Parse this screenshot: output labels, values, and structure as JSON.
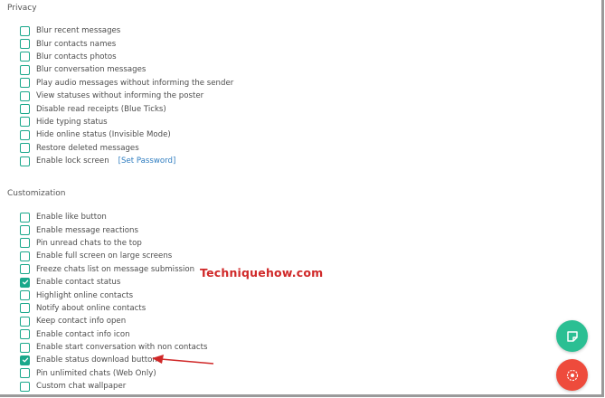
{
  "privacy": {
    "title": "Privacy",
    "options": [
      {
        "label": "Blur recent messages",
        "checked": false
      },
      {
        "label": "Blur contacts names",
        "checked": false
      },
      {
        "label": "Blur contacts photos",
        "checked": false
      },
      {
        "label": "Blur conversation messages",
        "checked": false
      },
      {
        "label": "Play audio messages without informing the sender",
        "checked": false
      },
      {
        "label": "View statuses without informing the poster",
        "checked": false
      },
      {
        "label": "Disable read receipts (Blue Ticks)",
        "checked": false
      },
      {
        "label": "Hide typing status",
        "checked": false
      },
      {
        "label": "Hide online status (Invisible Mode)",
        "checked": false
      },
      {
        "label": "Restore deleted messages",
        "checked": false
      },
      {
        "label": "Enable lock screen",
        "checked": false,
        "link": "[Set Password]"
      }
    ]
  },
  "customization": {
    "title": "Customization",
    "options": [
      {
        "label": "Enable like button",
        "checked": false
      },
      {
        "label": "Enable message reactions",
        "checked": false
      },
      {
        "label": "Pin unread chats to the top",
        "checked": false
      },
      {
        "label": "Enable full screen on large screens",
        "checked": false
      },
      {
        "label": "Freeze chats list on message submission",
        "checked": false
      },
      {
        "label": "Enable contact status",
        "checked": true
      },
      {
        "label": "Highlight online contacts",
        "checked": false
      },
      {
        "label": "Notify about online contacts",
        "checked": false
      },
      {
        "label": "Keep contact info open",
        "checked": false
      },
      {
        "label": "Enable contact info icon",
        "checked": false
      },
      {
        "label": "Enable start conversation with non contacts",
        "checked": false
      },
      {
        "label": "Enable status download button",
        "checked": true
      },
      {
        "label": "Pin unlimited chats (Web Only)",
        "checked": false
      },
      {
        "label": "Custom chat wallpaper",
        "checked": false
      }
    ]
  },
  "watermark": "Techniquehow.com",
  "fabs": [
    {
      "icon": "sticker-note-icon",
      "color": "#2bbf93"
    },
    {
      "icon": "record-target-icon",
      "color": "#ee4b3c"
    }
  ],
  "colors": {
    "checkbox": "#1aa88b",
    "link": "#2f7dc0",
    "annotation": "#d02828"
  }
}
